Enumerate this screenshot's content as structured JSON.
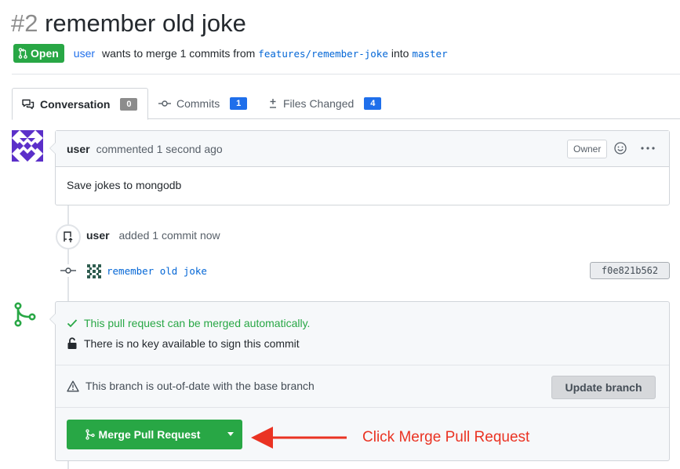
{
  "pr": {
    "number": "#2",
    "title": "remember old joke",
    "state": "Open",
    "author": "user",
    "merge_text": "wants to merge 1 commits from",
    "head_branch": "features/remember-joke",
    "into_text": "into",
    "base_branch": "master"
  },
  "tabs": [
    {
      "label": "Conversation",
      "count": "0",
      "icon": "comment-discussion-icon"
    },
    {
      "label": "Commits",
      "count": "1",
      "icon": "commit-icon"
    },
    {
      "label": "Files Changed",
      "count": "4",
      "icon": "diff-icon"
    }
  ],
  "comment": {
    "author": "user",
    "action": "commented 1 second ago",
    "role_badge": "Owner",
    "body": "Save jokes to mongodb"
  },
  "event": {
    "author": "user",
    "action": "added 1 commit now"
  },
  "commit": {
    "message": "remember old joke",
    "sha": "f0e821b562"
  },
  "merge": {
    "auto_status": "This pull request can be merged automatically.",
    "sign_status": "There is no key available to sign this commit",
    "outdated_status": "This branch is out-of-date with the base branch",
    "update_button": "Update branch",
    "merge_button": "Merge Pull Request"
  },
  "annotation": {
    "text": "Click Merge Pull Request",
    "color": "#ea3323"
  },
  "colors": {
    "green": "#28a745",
    "link": "#0366d6",
    "badge_blue": "#1f6feb"
  }
}
